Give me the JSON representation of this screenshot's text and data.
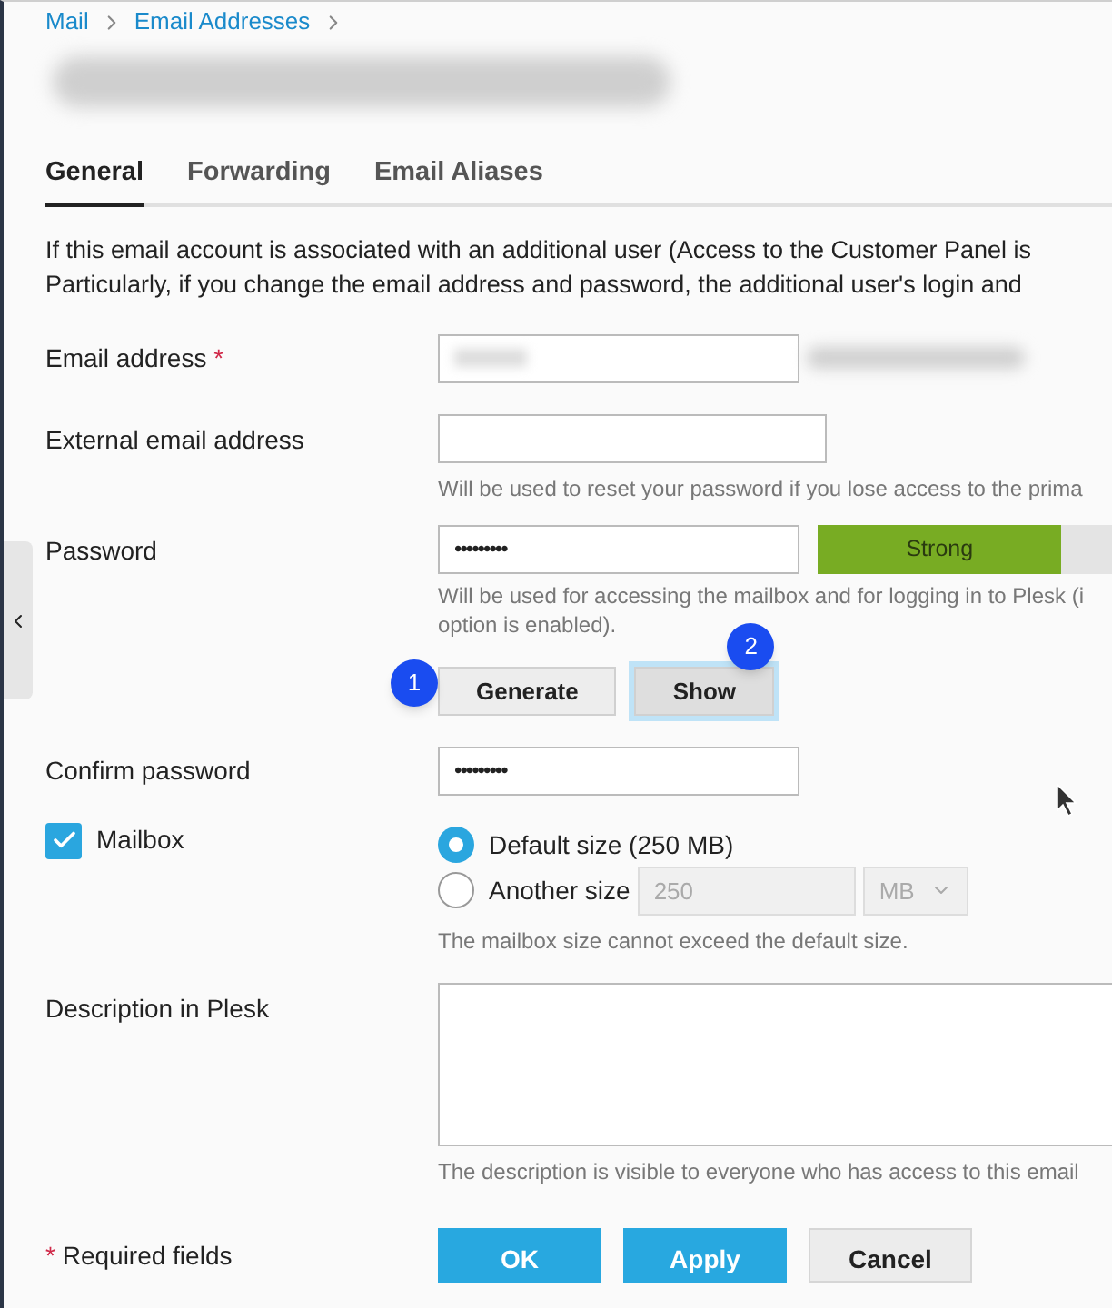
{
  "breadcrumbs": [
    "Mail",
    "Email Addresses"
  ],
  "tabs": [
    {
      "label": "General",
      "selected": true
    },
    {
      "label": "Forwarding",
      "selected": false
    },
    {
      "label": "Email Aliases",
      "selected": false
    }
  ],
  "intro": [
    "If this email account is associated with an additional user (Access to the Customer Panel is",
    "Particularly, if you change the email address and password, the additional user's login and"
  ],
  "email": {
    "label": "Email address",
    "required_mark": "*"
  },
  "external_email": {
    "label": "External email address",
    "hint": "Will be used to reset your password if you lose access to the prima"
  },
  "password": {
    "label": "Password",
    "value": "•••••••••",
    "strength": {
      "text": "Strong",
      "level": 0.79
    },
    "hint": [
      "Will be used for accessing the mailbox and for logging in to Plesk (i",
      "option is enabled)."
    ],
    "buttons": [
      {
        "label": "Generate",
        "focused": false,
        "marker": "1"
      },
      {
        "label": "Show",
        "focused": true,
        "marker": "2"
      }
    ]
  },
  "confirm_password": {
    "label": "Confirm password",
    "value": "•••••••••"
  },
  "mailbox": {
    "label": "Mailbox",
    "checked": true,
    "options": [
      {
        "label": "Default size (250 MB)",
        "selected": true
      },
      {
        "label": "Another size",
        "selected": false,
        "size_value": "250",
        "unit": "MB"
      }
    ],
    "hint": "The mailbox size cannot exceed the default size."
  },
  "description": {
    "label": "Description in Plesk",
    "hint": "The description is visible to everyone who has access to this email"
  },
  "footer": {
    "required_mark": "*",
    "required_text": "Required fields",
    "buttons": [
      {
        "label": "OK",
        "kind": "primary"
      },
      {
        "label": "Apply",
        "kind": "primary"
      },
      {
        "label": "Cancel",
        "kind": "secondary"
      }
    ]
  }
}
